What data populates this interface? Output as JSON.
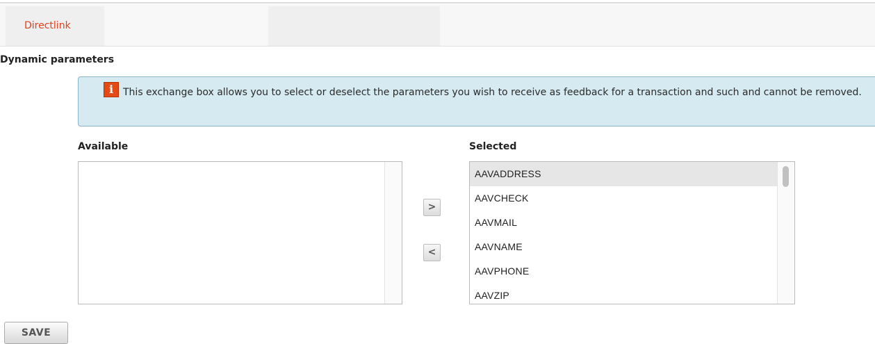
{
  "tabs": [
    {
      "label": "Directlink",
      "active": true
    },
    {
      "label": ""
    },
    {
      "label": ""
    }
  ],
  "section_title": "Dynamic parameters",
  "info": {
    "icon": "info-icon",
    "text": "This exchange box allows you to select or deselect the parameters you wish to receive as feedback for a transaction and such and cannot be removed."
  },
  "available": {
    "label": "Available",
    "items": []
  },
  "selected": {
    "label": "Selected",
    "items": [
      "AAVADDRESS",
      "AAVCHECK",
      "AAVMAIL",
      "AAVNAME",
      "AAVPHONE",
      "AAVZIP"
    ]
  },
  "controls": {
    "move_right": ">",
    "move_left": "<"
  },
  "save_label": "SAVE",
  "colors": {
    "tab_active_text": "#e2401c",
    "info_bg": "#d5eaf1",
    "info_border": "#8ab5c6",
    "info_icon": "#e34a16"
  }
}
